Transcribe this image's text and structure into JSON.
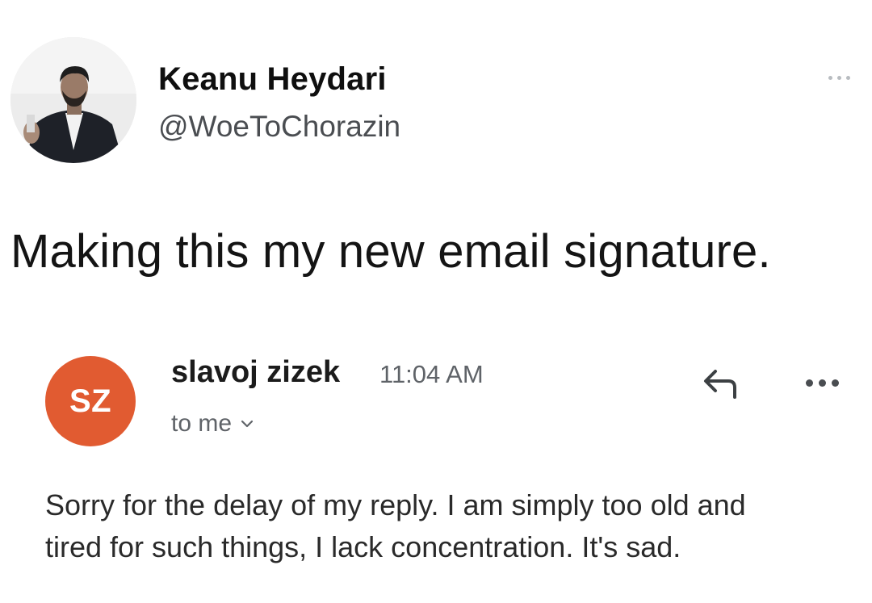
{
  "tweet": {
    "author_name": "Keanu Heydari",
    "author_handle": "@WoeToChorazin",
    "text": "Making this my new email signature.",
    "more_icon": "ellipsis-icon"
  },
  "email": {
    "sender_initials": "SZ",
    "sender_name": "slavoj zizek",
    "time": "11:04 AM",
    "recipient_label": "to me",
    "avatar_color": "#e15b31",
    "reply_icon": "reply-arrow-icon",
    "more_icon": "ellipsis-icon",
    "body_lines": [
      "Sorry for the delay of my reply. I am simply too old and",
      "tired for such things, I lack concentration. It's sad."
    ]
  }
}
